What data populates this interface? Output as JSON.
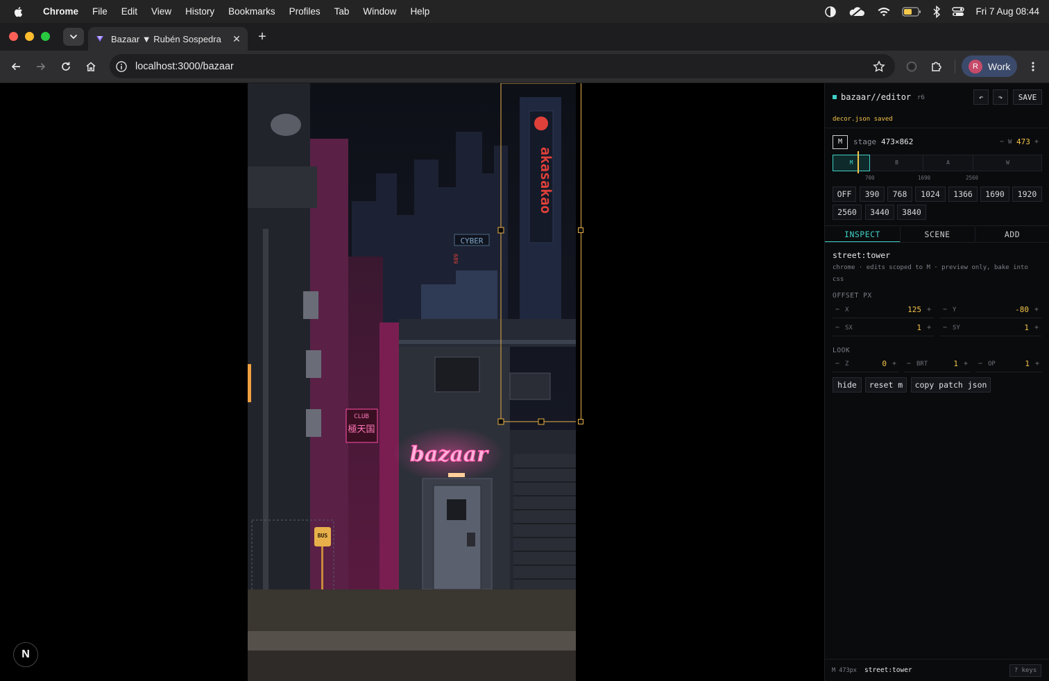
{
  "menubar": {
    "app_name": "Chrome",
    "items": [
      "File",
      "Edit",
      "View",
      "History",
      "Bookmarks",
      "Profiles",
      "Tab",
      "Window",
      "Help"
    ],
    "datetime": "Fri 7 Aug  08:44"
  },
  "browser": {
    "tab_title": "Bazaar ▼ Rubén Sospedra",
    "url": "localhost:3000/bazaar",
    "profile_initial": "R",
    "profile_label": "Work"
  },
  "scene": {
    "sign_text": "bazaar",
    "bus_stop": "BUS",
    "cyber_sign": "CYBER",
    "vertical_sign": "akasakao",
    "club_sign": "CLUB",
    "club_kanji": "極天国",
    "small_sign": "689"
  },
  "next_badge": "N",
  "editor": {
    "title": "bazaar//editor",
    "revision": "r6",
    "undo_label": "↶",
    "redo_label": "↷",
    "save_label": "SAVE",
    "status": "decor.json saved",
    "mode_badge": "M",
    "stage_label": "stage",
    "stage_size": "473×862",
    "width_label": "W",
    "width_value": "473",
    "segments": [
      "M",
      "B",
      "A",
      "W"
    ],
    "ruler_ticks": [
      "700",
      "1690",
      "2560"
    ],
    "breakpoints_row1": [
      "OFF",
      "390",
      "768",
      "1024",
      "1366",
      "1690",
      "1920"
    ],
    "breakpoints_row2": [
      "2560",
      "3440",
      "3840"
    ],
    "tabs": [
      "INSPECT",
      "SCENE",
      "ADD"
    ],
    "selected": "street:tower",
    "selected_note": "chrome · edits scoped to M · preview only, bake into css",
    "offset_label": "OFFSET PX",
    "fields": {
      "x": {
        "name": "X",
        "value": "125"
      },
      "y": {
        "name": "Y",
        "value": "-80"
      },
      "sx": {
        "name": "SX",
        "value": "1"
      },
      "sy": {
        "name": "SY",
        "value": "1"
      },
      "z": {
        "name": "Z",
        "value": "0"
      },
      "brt": {
        "name": "BRT",
        "value": "1"
      },
      "op": {
        "name": "OP",
        "value": "1"
      }
    },
    "look_label": "LOOK",
    "actions": [
      "hide",
      "reset m",
      "copy patch json"
    ],
    "footer_mode": "M 473px",
    "footer_selected": "street:tower",
    "keys_label": "? keys"
  },
  "colors": {
    "accent_teal": "#3fd0c6",
    "value_yellow": "#f5c54a",
    "selection_orange": "#e8b04a",
    "neon_pink": "#ff4fa8",
    "neon_red": "#e0403a"
  }
}
